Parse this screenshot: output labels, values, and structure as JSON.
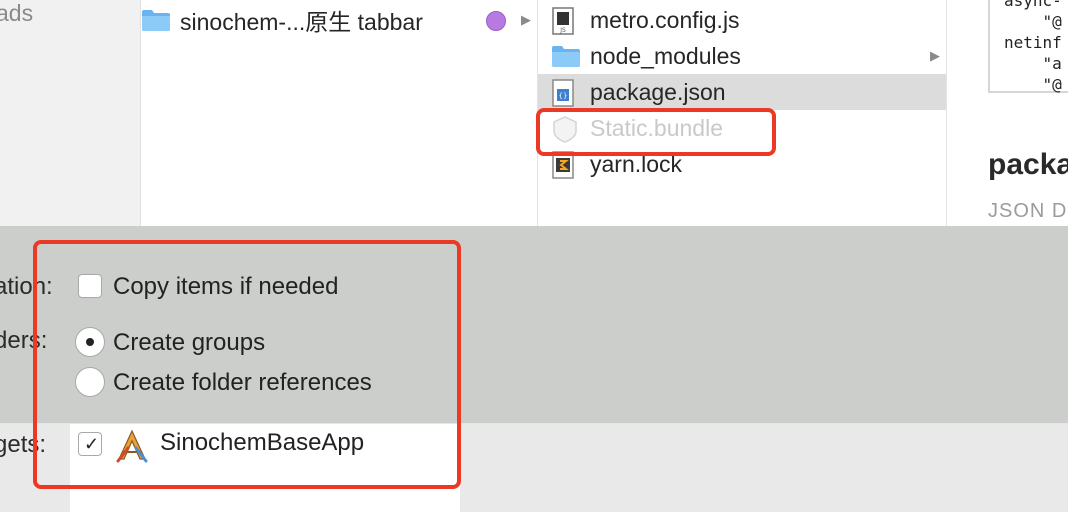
{
  "sidebar": {
    "downloads_fragment": "ads"
  },
  "column1": {
    "folder_name": "sinochem-...原生 tabbar",
    "tag_color": "#b67ae0"
  },
  "column2": {
    "items": [
      {
        "name": "metro.config.js",
        "icon": "js-file-icon"
      },
      {
        "name": "node_modules",
        "icon": "folder-icon"
      },
      {
        "name": "package.json",
        "icon": "json-file-icon",
        "selected": true
      },
      {
        "name": "Static.bundle",
        "icon": "bundle-icon",
        "disabled": true
      },
      {
        "name": "yarn.lock",
        "icon": "lock-file-icon"
      }
    ]
  },
  "preview": {
    "code": "async-\n    \"@\nnetinf\n    \"a\n    \"@",
    "title": "packa",
    "subtitle": "JSON D"
  },
  "options": {
    "destination_label": "ation:",
    "copy_items_label": "Copy items if needed",
    "copy_items_checked": false,
    "folders_label": "ders:",
    "create_groups_label": "Create groups",
    "create_folder_refs_label": "Create folder references",
    "selected_folder_option": "Create groups",
    "targets_label": "gets:",
    "target_name": "SinochemBaseApp",
    "target_checked": true
  },
  "colors": {
    "highlight": "#ea3a26",
    "selection": "#dcdcdc"
  }
}
